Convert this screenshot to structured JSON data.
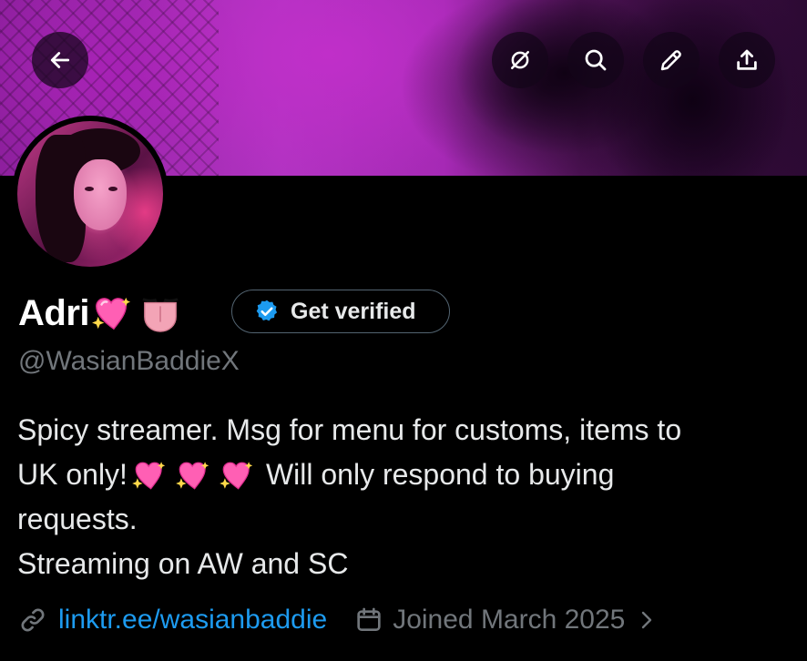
{
  "header": {
    "back_icon": "arrow-left-icon",
    "actions": [
      "grok-icon",
      "search-icon",
      "edit-icon",
      "share-icon"
    ]
  },
  "profile": {
    "name": "Adri",
    "name_emojis": [
      "sparkling-heart",
      "tongue"
    ],
    "verify_label": "Get verified",
    "handle": "@WasianBaddieX",
    "bio_lines": [
      "Spicy streamer. Msg for menu for customs, items to",
      "UK only!",
      "Will only respond to buying",
      "requests.",
      "Streaming on AW and SC"
    ],
    "link": "linktr.ee/wasianbaddie",
    "joined": "Joined March 2025"
  },
  "colors": {
    "background": "#000000",
    "accent": "#1d9bf0",
    "muted": "#71767b",
    "text": "#e7e9ea"
  }
}
